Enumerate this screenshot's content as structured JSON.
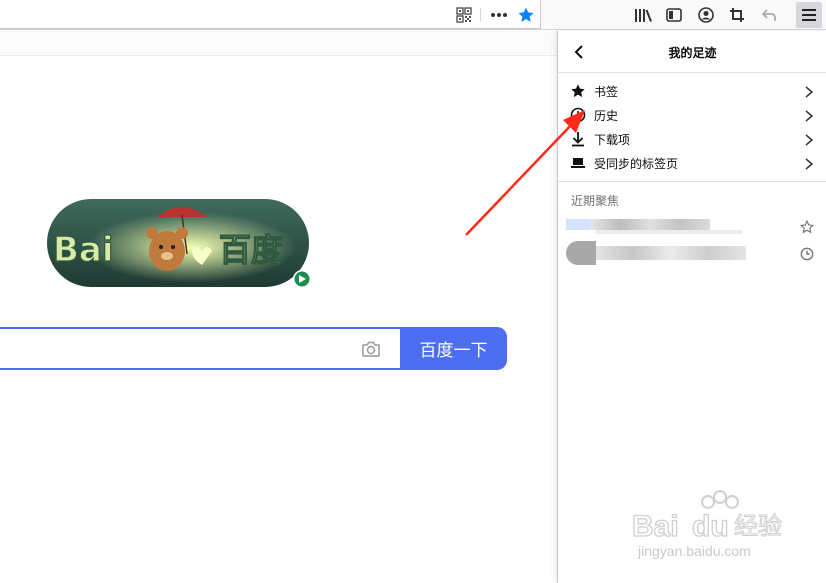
{
  "toolbar": {
    "icons": [
      "qr-code-icon",
      "more-icon",
      "bookmark-star-icon",
      "library-icon",
      "sidebar-icon",
      "account-icon",
      "screenshot-icon",
      "undo-icon",
      "menu-icon"
    ],
    "accent_color": "#0a84ff"
  },
  "baidu": {
    "doodle_text_left": "Bai",
    "doodle_text_right": "百度",
    "search_button_label": "百度一下",
    "brand_color": "#4e6ef2"
  },
  "panel": {
    "title": "我的足迹",
    "items": [
      {
        "label": "书签",
        "icon": "star-icon"
      },
      {
        "label": "历史",
        "icon": "clock-icon"
      },
      {
        "label": "下载项",
        "icon": "download-icon"
      },
      {
        "label": "受同步的标签页",
        "icon": "synced-tabs-icon"
      }
    ],
    "section_label": "近期聚焦"
  },
  "watermark": {
    "logo": "Bai du 经验",
    "url": "jingyan.baidu.com"
  }
}
